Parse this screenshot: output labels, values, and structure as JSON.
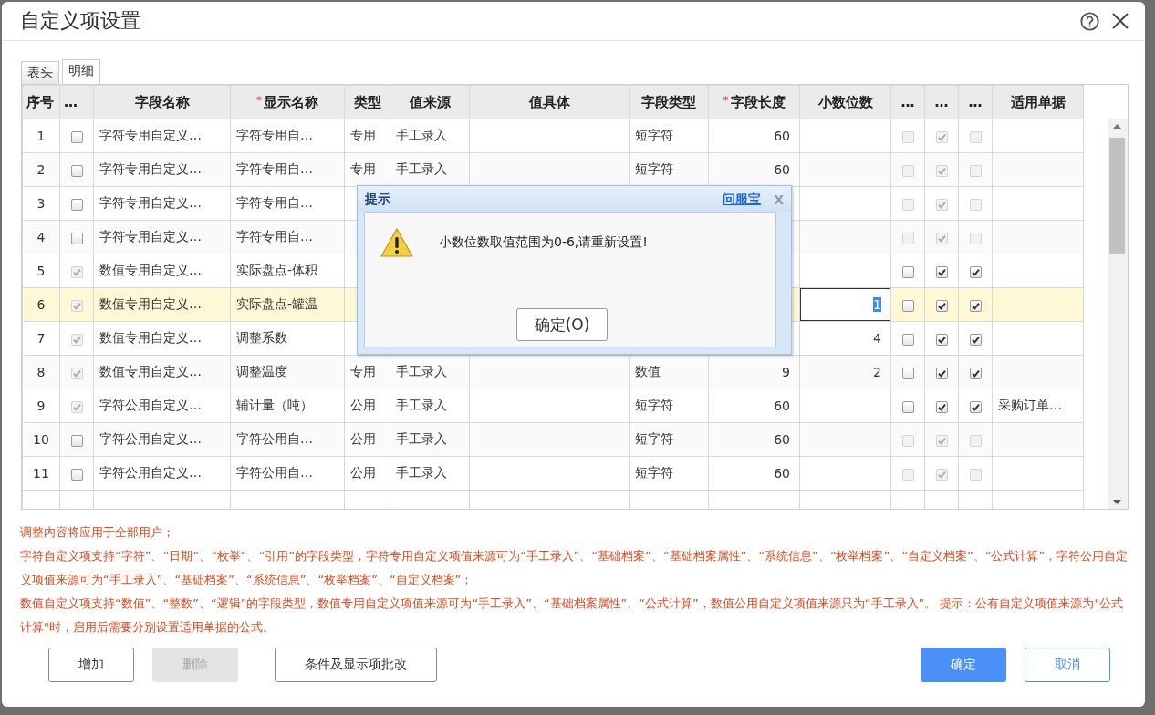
{
  "dialog": {
    "title": "自定义项设置"
  },
  "tabs": [
    {
      "label": "表头",
      "selected": false
    },
    {
      "label": "明细",
      "selected": true
    }
  ],
  "table": {
    "columns": [
      {
        "label": "序号"
      },
      {
        "label": "…"
      },
      {
        "label": "字段名称"
      },
      {
        "label": "显示名称",
        "mark": "*"
      },
      {
        "label": "类型"
      },
      {
        "label": "值来源"
      },
      {
        "label": "值具体"
      },
      {
        "label": "字段类型"
      },
      {
        "label": "字段长度",
        "mark": "*"
      },
      {
        "label": "小数位数"
      },
      {
        "label": "…"
      },
      {
        "label": "…"
      },
      {
        "label": "…"
      },
      {
        "label": "适用单据"
      }
    ],
    "rows": [
      {
        "no": "1",
        "check": {
          "checked": false,
          "disabled": false
        },
        "field_name": "字符专用自定义…",
        "display_name": "字符专用自…",
        "type": "专用",
        "source": "手工录入",
        "field_type": "短字符",
        "length": "60",
        "flags": [
          {
            "checked": false,
            "disabled": true
          },
          {
            "checked": true,
            "disabled": true
          },
          {
            "checked": false,
            "disabled": true
          }
        ],
        "selected": false
      },
      {
        "no": "2",
        "check": {
          "checked": false,
          "disabled": false
        },
        "field_name": "字符专用自定义…",
        "display_name": "字符专用自…",
        "type": "专用",
        "source": "手工录入",
        "field_type": "短字符",
        "length": "60",
        "flags": [
          {
            "checked": false,
            "disabled": true
          },
          {
            "checked": true,
            "disabled": true
          },
          {
            "checked": false,
            "disabled": true
          }
        ],
        "selected": false
      },
      {
        "no": "3",
        "check": {
          "checked": false,
          "disabled": false
        },
        "field_name": "字符专用自定义…",
        "display_name": "字符专用自…",
        "flags": [
          {
            "checked": false,
            "disabled": true
          },
          {
            "checked": true,
            "disabled": true
          },
          {
            "checked": false,
            "disabled": true
          }
        ],
        "selected": false
      },
      {
        "no": "4",
        "check": {
          "checked": false,
          "disabled": false
        },
        "field_name": "字符专用自定义…",
        "display_name": "字符专用自…",
        "flags": [
          {
            "checked": false,
            "disabled": true
          },
          {
            "checked": true,
            "disabled": true
          },
          {
            "checked": false,
            "disabled": true
          }
        ],
        "selected": false
      },
      {
        "no": "5",
        "check": {
          "checked": true,
          "disabled": true
        },
        "field_name": "数值专用自定义…",
        "display_name": "实际盘点-体积",
        "flags": [
          {
            "checked": false,
            "disabled": false
          },
          {
            "checked": true,
            "disabled": false
          },
          {
            "checked": true,
            "disabled": false
          }
        ],
        "selected": false
      },
      {
        "no": "6",
        "check": {
          "checked": true,
          "disabled": true
        },
        "field_name": "数值专用自定义…",
        "display_name": "实际盘点-罐温",
        "decimals_input": {
          "value": "1"
        },
        "flags": [
          {
            "checked": false,
            "disabled": false
          },
          {
            "checked": true,
            "disabled": false
          },
          {
            "checked": true,
            "disabled": false
          }
        ],
        "selected": true
      },
      {
        "no": "7",
        "check": {
          "checked": true,
          "disabled": true
        },
        "field_name": "数值专用自定义…",
        "display_name": "调整系数",
        "decimals": "4",
        "flags": [
          {
            "checked": false,
            "disabled": false
          },
          {
            "checked": true,
            "disabled": false
          },
          {
            "checked": true,
            "disabled": false
          }
        ],
        "selected": false
      },
      {
        "no": "8",
        "check": {
          "checked": true,
          "disabled": true
        },
        "field_name": "数值专用自定义…",
        "display_name": "调整温度",
        "type": "专用",
        "source": "手工录入",
        "field_type": "数值",
        "length": "9",
        "decimals": "2",
        "flags": [
          {
            "checked": false,
            "disabled": false
          },
          {
            "checked": true,
            "disabled": false
          },
          {
            "checked": true,
            "disabled": false
          }
        ],
        "selected": false
      },
      {
        "no": "9",
        "check": {
          "checked": true,
          "disabled": true
        },
        "field_name": "字符公用自定义…",
        "display_name": "辅计量（吨）",
        "type": "公用",
        "source": "手工录入",
        "field_type": "短字符",
        "length": "60",
        "flags": [
          {
            "checked": false,
            "disabled": false
          },
          {
            "checked": true,
            "disabled": false
          },
          {
            "checked": true,
            "disabled": false
          }
        ],
        "applies_to": "采购订单…",
        "selected": false
      },
      {
        "no": "10",
        "check": {
          "checked": false,
          "disabled": false
        },
        "field_name": "字符公用自定义…",
        "display_name": "字符公用自…",
        "type": "公用",
        "source": "手工录入",
        "field_type": "短字符",
        "length": "60",
        "flags": [
          {
            "checked": false,
            "disabled": true
          },
          {
            "checked": true,
            "disabled": true
          },
          {
            "checked": false,
            "disabled": true
          }
        ],
        "selected": false
      },
      {
        "no": "11",
        "check": {
          "checked": false,
          "disabled": false
        },
        "field_name": "字符公用自定义…",
        "display_name": "字符公用自…",
        "type": "公用",
        "source": "手工录入",
        "field_type": "短字符",
        "length": "60",
        "flags": [
          {
            "checked": false,
            "disabled": true
          },
          {
            "checked": true,
            "disabled": true
          },
          {
            "checked": false,
            "disabled": true
          }
        ],
        "selected": false
      }
    ]
  },
  "notes": [
    "调整内容将应用于全部用户；",
    "字符自定义项支持“字符”、“日期”、“枚举”、“引用”的字段类型，字符专用自定义项值来源可为“手工录入”、“基础档案”、“基础档案属性”、“系统信息”、“枚举档案”、“自定义档案”、“公式计算”，字符公用自定义项值来源可为“手工录入”、“基础档案”、“系统信息”、“枚举档案”、“自定义档案”；",
    "数值自定义项支持“数值”、“整数”、“逻辑”的字段类型，数值专用自定义项值来源可为“手工录入”、“基础档案属性”、“公式计算”，数值公用自定义项值来源只为“手工录入”。 提示：公有自定义项值来源为\"公式计算\"时，启用后需要分别设置适用单据的公式。"
  ],
  "buttons": [
    {
      "label": "增加",
      "kind": "plain",
      "disabled": false
    },
    {
      "label": "删除",
      "kind": "plain",
      "disabled": true
    },
    {
      "label": "条件及显示项批改",
      "kind": "plain",
      "disabled": false
    },
    {
      "label": "确定",
      "kind": "primary",
      "disabled": false
    },
    {
      "label": "取消",
      "kind": "outline",
      "disabled": false
    }
  ],
  "alert": {
    "title": "提示",
    "help_link": "问服宝",
    "close": "X",
    "message": "小数位数取值范围为0-6,请重新设置!",
    "button": "确定(O)"
  }
}
